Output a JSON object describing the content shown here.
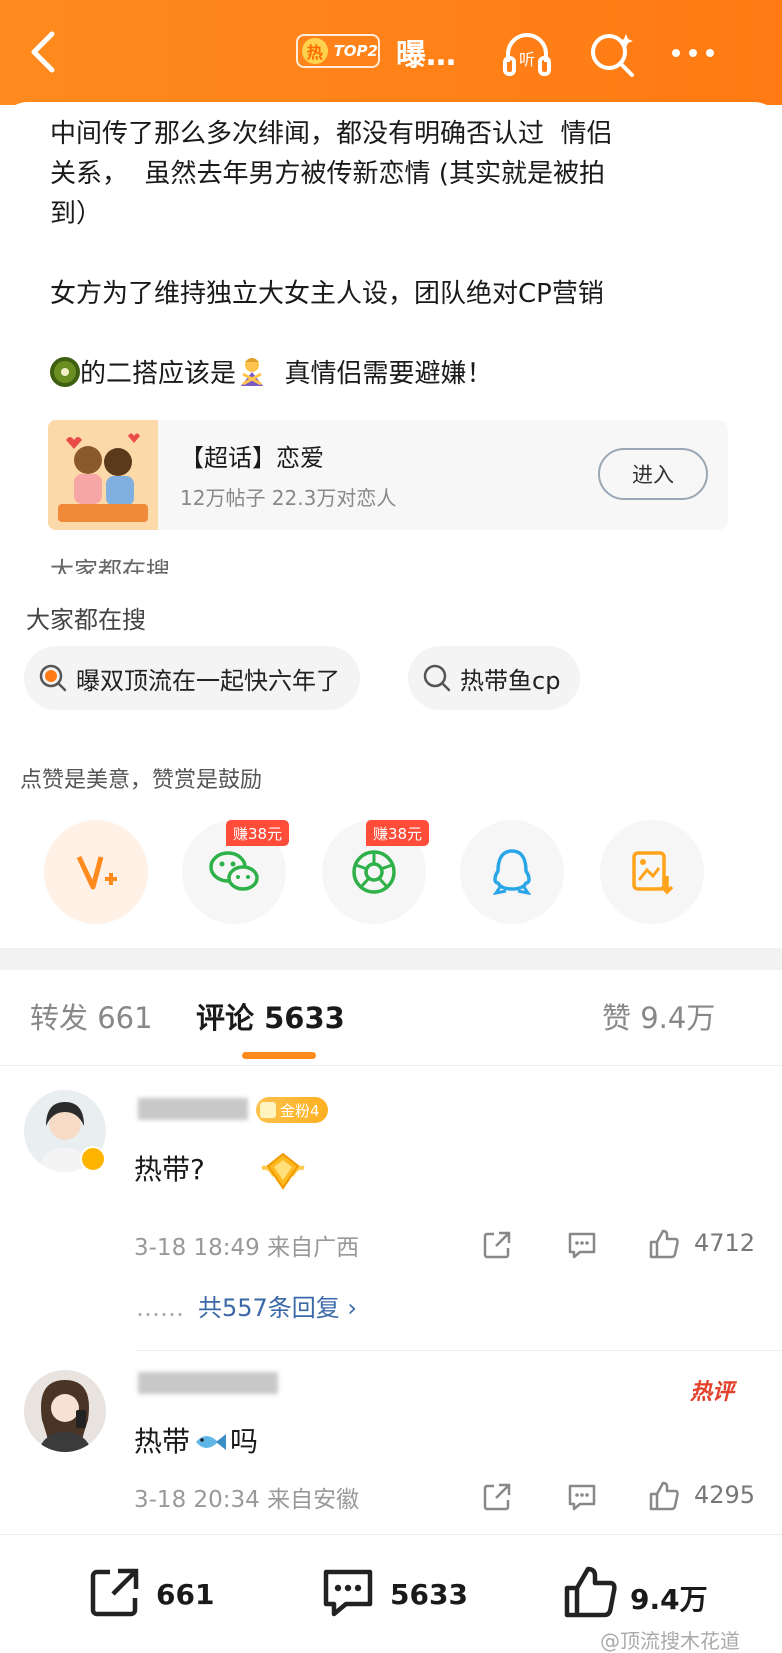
{
  "header": {
    "hot_char": "热",
    "rank_label": "TOP2",
    "title": "曝…",
    "icons": [
      "back-icon",
      "listen-icon",
      "search-icon",
      "more-icon"
    ],
    "listen_label": "听",
    "accent": "#ff7a12"
  },
  "post": {
    "line1": "中间传了那么多次绯闻，都没有明确否认过  情侣",
    "line2": "关系，  虽然去年男方被传新恋情 (其实就是被拍",
    "line3": "到）",
    "line4": "女方为了维持独立大女主人设，团队绝对CP营销",
    "line5a": "的二搭应该是",
    "line5b": "  真情侣需要避嫌！",
    "cut_text": "大家都在搜"
  },
  "topic": {
    "name": "【超话】恋爱",
    "stats": "12万帖子 22.3万对恋人",
    "enter_label": "进入"
  },
  "search": {
    "title": "大家都在搜",
    "chips": [
      "曝双顶流在一起快六年了",
      "热带鱼cp"
    ]
  },
  "reward": {
    "note": "点赞是美意，赞赏是鼓励",
    "earn_tags": [
      "赚38元",
      "赚38元"
    ]
  },
  "tabs": {
    "repost": "转发 661",
    "comment": "评论 5633",
    "like": "赞 9.4万"
  },
  "comments": [
    {
      "badge": "金粉4",
      "text": "热带?",
      "time": "3-18 18:49  来自广西",
      "likes": "4712",
      "replies": "共557条回复 ›",
      "dots": "……"
    },
    {
      "tag": "热评",
      "text_a": "热带",
      "text_b": "吗",
      "time": "3-18 20:34  来自安徽",
      "likes": "4295"
    }
  ],
  "bottom": {
    "repost": "661",
    "comment": "5633",
    "like": "9.4万"
  },
  "watermark": "@顶流搜木花道"
}
